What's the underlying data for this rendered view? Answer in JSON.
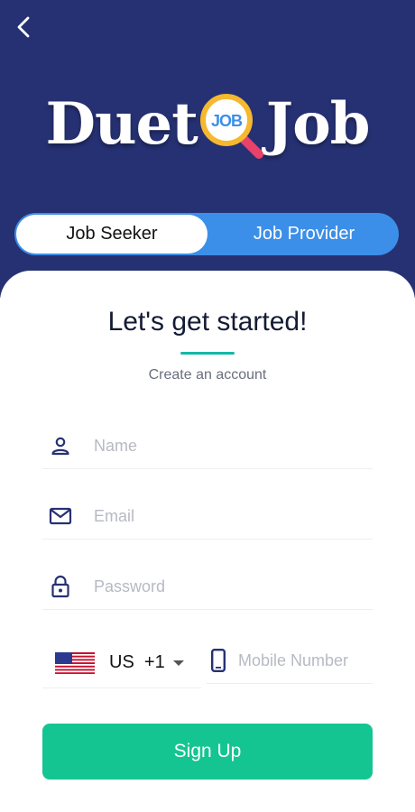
{
  "header": {
    "logo_left": "Duet",
    "logo_badge": "JOB",
    "logo_right": "Job",
    "background_color": "#263173"
  },
  "toggle": {
    "seeker_label": "Job Seeker",
    "provider_label": "Job Provider",
    "selected": "Job Seeker"
  },
  "form": {
    "title": "Let's get started!",
    "subtitle": "Create an account",
    "name_placeholder": "Name",
    "email_placeholder": "Email",
    "password_placeholder": "Password",
    "country_code": "US  +1",
    "mobile_placeholder": "Mobile Number",
    "signup_label": "Sign Up"
  },
  "icons": {
    "back": "chevron-left-icon",
    "name": "person-icon",
    "email": "mail-icon",
    "password": "lock-icon",
    "flag": "us-flag-icon",
    "dropdown": "caret-down-icon",
    "mobile": "phone-icon"
  },
  "colors": {
    "accent": "#14b8a6",
    "button": "#14c592",
    "toggle_active_bg": "#3c8fe8",
    "icon": "#263173"
  }
}
